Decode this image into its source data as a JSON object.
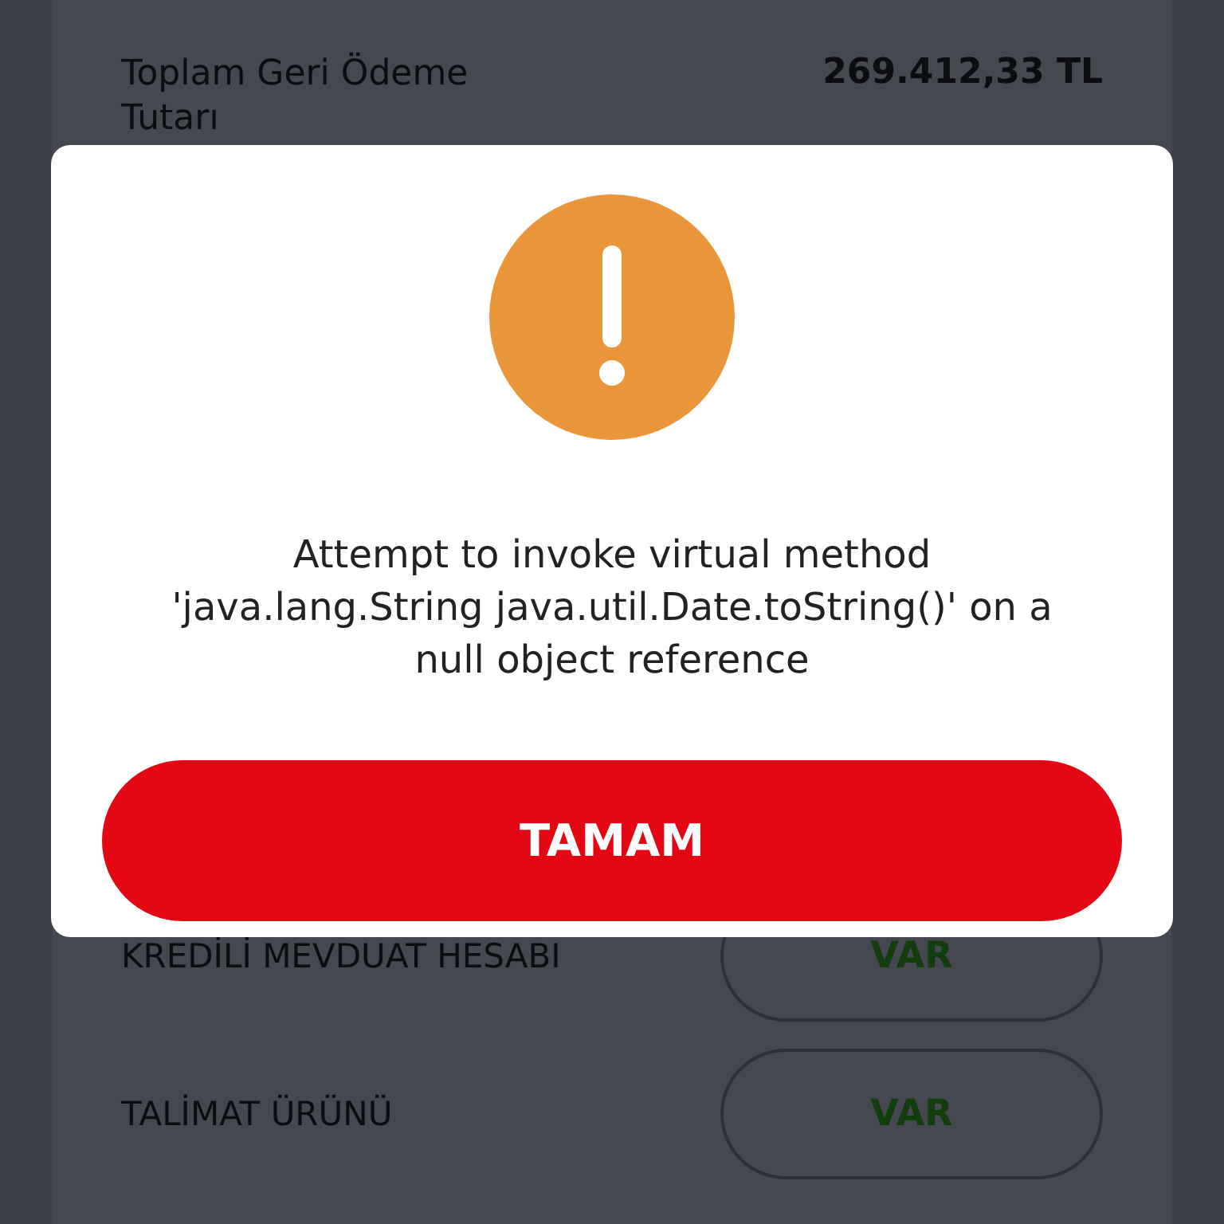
{
  "summary": {
    "label": "Toplam Geri Ödeme Tutarı",
    "value": "269.412,33 TL"
  },
  "products": [
    {
      "label": "KREDİLİ MEVDUAT HESABI",
      "status": "VAR"
    },
    {
      "label": "TALİMAT ÜRÜNÜ",
      "status": "VAR"
    }
  ],
  "dialog": {
    "kind": "warning",
    "message": "Attempt to invoke virtual method 'java.lang.String java.util.Date.toString()' on a null object reference",
    "button": "TAMAM"
  }
}
